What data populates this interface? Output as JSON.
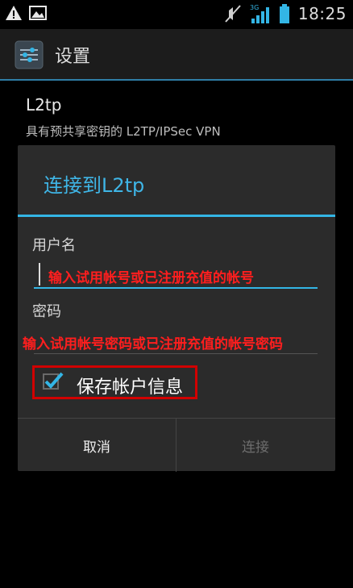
{
  "status_bar": {
    "time": "18:25",
    "network": "3G",
    "icons": [
      "warning-icon",
      "image-icon",
      "mute-icon",
      "signal-icon",
      "battery-icon"
    ]
  },
  "action_bar": {
    "title": "设置",
    "icon": "settings-icon"
  },
  "list_item": {
    "title": "L2tp",
    "subtitle": "具有预共享密钥的 L2TP/IPSec VPN"
  },
  "dialog": {
    "title": "连接到L2tp",
    "username_label": "用户名",
    "username_hint": "输入试用帐号或已注册充值的帐号",
    "password_label": "密码",
    "password_hint": "输入试用帐号密码或已注册充值的帐号密码",
    "save_account_label": "保存帐户信息",
    "save_account_checked": true,
    "cancel_label": "取消",
    "connect_label": "连接"
  },
  "colors": {
    "accent": "#33b5e5",
    "annotation_red": "#ff1e1e",
    "dialog_bg": "#2b2b2b"
  }
}
